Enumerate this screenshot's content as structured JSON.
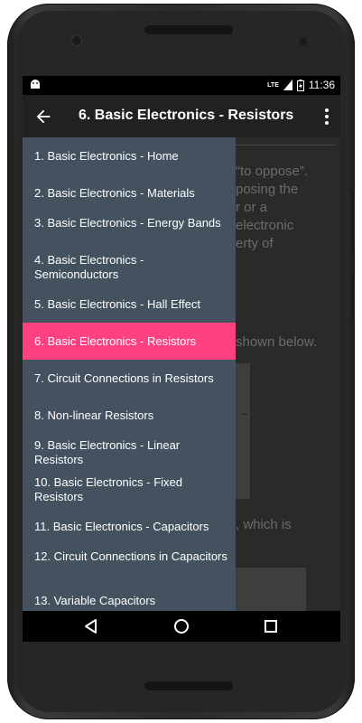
{
  "status_bar": {
    "time": "11:36",
    "network_label": "LTE",
    "icons": [
      "android-notification-icon",
      "signal-icon",
      "battery-charging-icon"
    ]
  },
  "app_bar": {
    "title": "6. Basic Electronics - Resistors",
    "back_icon": "arrow-back-icon",
    "menu_icon": "more-vert-icon"
  },
  "content": {
    "para_lines": [
      "“to oppose”.",
      "posing the",
      "r or a",
      "electronic",
      "erty of"
    ],
    "shown_text": "shown below.",
    "which_text": ", which is"
  },
  "drawer": {
    "selected_color": "#ff4081",
    "background_color": "#445260",
    "items": [
      {
        "label": "1. Basic Electronics - Home"
      },
      {
        "label": "2. Basic Electronics - Materials"
      },
      {
        "label": "3. Basic Electronics - Energy Bands"
      },
      {
        "label": "4. Basic Electronics - Semiconductors"
      },
      {
        "label": "5. Basic Electronics - Hall Effect"
      },
      {
        "label": "6. Basic Electronics - Resistors",
        "selected": true
      },
      {
        "label": "7. Circuit Connections in Resistors"
      },
      {
        "label": "8. Non-linear Resistors"
      },
      {
        "label": "9. Basic Electronics - Linear Resistors"
      },
      {
        "label": "10. Basic Electronics - Fixed Resistors"
      },
      {
        "label": "11. Basic Electronics - Capacitors"
      },
      {
        "label": "12. Circuit Connections in Capacitors"
      },
      {
        "label": "13. Variable Capacitors"
      }
    ]
  },
  "nav_bar": {
    "buttons": [
      "back-triangle-icon",
      "home-circle-icon",
      "recents-square-icon"
    ]
  }
}
